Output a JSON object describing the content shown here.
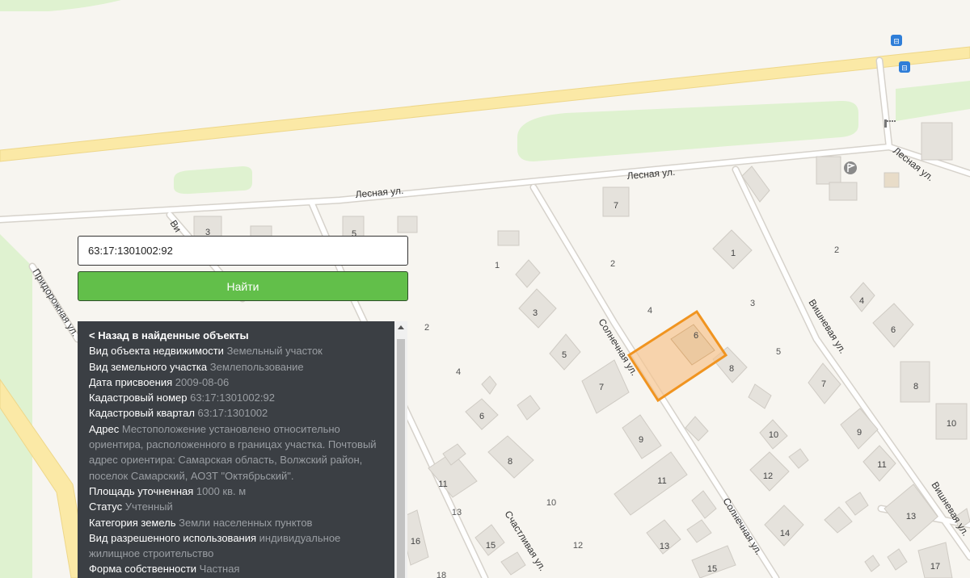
{
  "search": {
    "value": "63:17:1301002:92",
    "button_label": "Найти"
  },
  "info": {
    "back": "< Назад в найденные объекты",
    "rows": [
      {
        "label": "Вид объекта недвижимости",
        "value": "Земельный участок"
      },
      {
        "label": "Вид земельного участка",
        "value": "Землепользование"
      },
      {
        "label": "Дата присвоения",
        "value": "2009-08-06"
      },
      {
        "label": "Кадастровый номер",
        "value": "63:17:1301002:92"
      },
      {
        "label": "Кадастровый квартал",
        "value": "63:17:1301002"
      },
      {
        "label": "Адрес",
        "value": "Местоположение установлено относительно ориентира, расположенного в границах участка. Почтовый адрес ориентира: Самарская область, Волжский район, поселок Самарский, АОЗТ \"Октябрьский\"."
      },
      {
        "label": "Площадь уточненная",
        "value": "1000 кв. м"
      },
      {
        "label": "Статус",
        "value": "Учтенный"
      },
      {
        "label": "Категория земель",
        "value": "Земли населенных пунктов"
      },
      {
        "label": "Вид разрешенного использования",
        "value": "индивидуальное жилищное строительство"
      },
      {
        "label": "Форма собственности",
        "value": "Частная"
      }
    ]
  },
  "map": {
    "streets": {
      "lesnaya_1": "Лесная ул.",
      "lesnaya_2": "Лесная ул.",
      "lesnaya_3": "Лесная ул.",
      "pridorozhnaya": "Придорожная ул.",
      "vishnevaya_partial": "Ви",
      "solnechnaya_1": "Солнечная ул.",
      "solnechnaya_2": "Солнечная ул.",
      "vishnevaya_1": "Вишневая ул.",
      "vishnevaya_2": "Вишневая ул.",
      "schastlivaya": "Счастливая ул."
    },
    "house_numbers": {
      "h3_top": "3",
      "h5_top": "5",
      "h7_top": "7",
      "h1_right": "1",
      "h4_r": "4",
      "h6_r": "6",
      "h8_r": "8",
      "h10_r": "10",
      "h9_r": "9",
      "h11_r": "11",
      "h13_r": "13",
      "h17_r": "17",
      "h3_mid": "3",
      "h5_mid": "5",
      "h7_mid": "7",
      "h8_near": "8",
      "h6_sel": "6",
      "h9_mid": "9",
      "h10_mid": "10",
      "h12_mid": "12",
      "h11_mid": "11",
      "h14_mid": "14",
      "h13_mid": "13",
      "h15_mid": "15",
      "h6_left": "6",
      "h8_left": "8",
      "h11_left": "11",
      "h16_left": "16",
      "h15_left": "15",
      "h7_right": "7",
      "h9_right": "9"
    },
    "plot_numbers": {
      "p1": "1",
      "p2_a": "2",
      "p4_a": "4",
      "p3_a": "3",
      "p5_a": "5",
      "p2_b": "2",
      "p2_left": "2",
      "p4_left": "4",
      "p10": "10",
      "p12": "12",
      "p13": "13",
      "p18": "18"
    },
    "colors": {
      "selected_fill": "#f7c58f",
      "selected_stroke": "#f09420",
      "green": "#dff2d0",
      "road_yellow": "#fbe9a6"
    }
  }
}
